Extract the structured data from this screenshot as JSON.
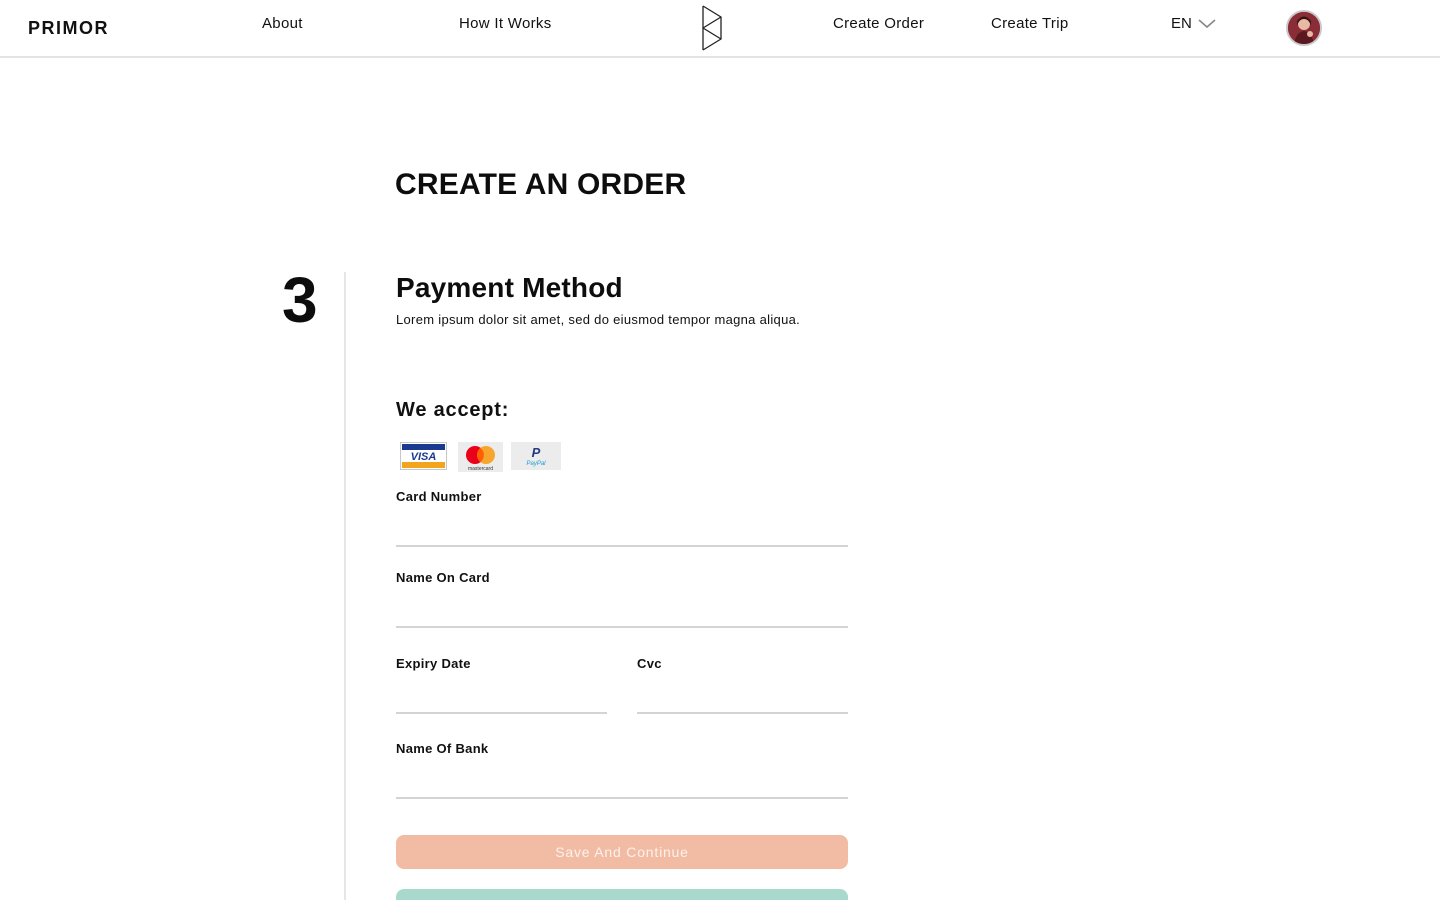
{
  "header": {
    "brand": "PRIMOR",
    "nav": {
      "about": "About",
      "how_it_works": "How It Works",
      "create_order": "Create Order",
      "create_trip": "Create Trip"
    },
    "language": "EN"
  },
  "main": {
    "title": "CREATE AN ORDER",
    "step_number": "3",
    "section_title": "Payment Method",
    "section_desc": "Lorem ipsum dolor sit amet, sed do eiusmod tempor magna aliqua.",
    "accept_title": "We accept:",
    "card_logos": {
      "visa": "VISA",
      "mastercard": "mastercard",
      "paypal": "PayPal"
    },
    "fields": {
      "card_number": {
        "label": "Card Number",
        "value": ""
      },
      "name_on_card": {
        "label": "Name On Card",
        "value": ""
      },
      "expiry_date": {
        "label": "Expiry Date",
        "value": ""
      },
      "cvc": {
        "label": "Cvc",
        "value": ""
      },
      "name_of_bank": {
        "label": "Name Of Bank",
        "value": ""
      }
    },
    "save_button": "Save And Continue"
  },
  "colors": {
    "save_button": "#f2bba3",
    "secondary_button": "#a9d9cc",
    "divider": "#e3e3e3"
  },
  "icons": {
    "logo": "primor-logo-mark",
    "language": "chevron-down-icon",
    "avatar": "user-avatar"
  }
}
